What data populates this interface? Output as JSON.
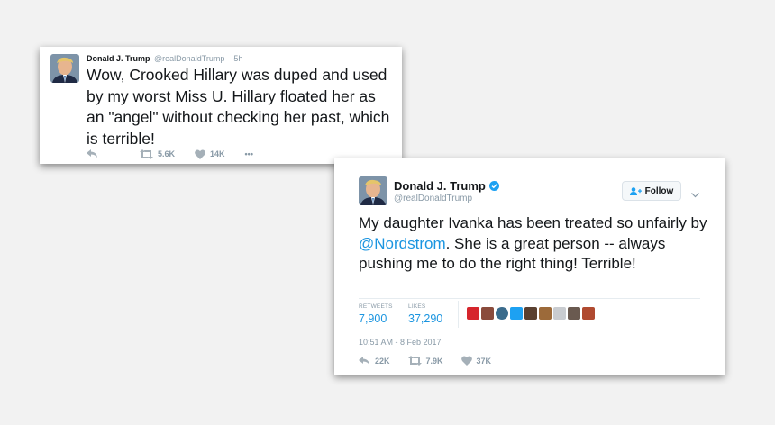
{
  "tweet1": {
    "name": "Donald J. Trump",
    "handle": "@realDonaldTrump",
    "time": "· 5h",
    "text": "Wow, Crooked Hillary was duped and used by my worst Miss U. Hillary floated her as an \"angel\" without checking her past, which is terrible!",
    "retweets": "5.6K",
    "likes": "14K",
    "more": "•••"
  },
  "tweet2": {
    "name": "Donald J. Trump",
    "handle": "@realDonaldTrump",
    "follow_label": "Follow",
    "text_before": "My daughter Ivanka has been treated so unfairly by ",
    "mention": "@Nordstrom",
    "text_after": ". She is a great person -- always pushing me to do the right thing! Terrible!",
    "retweets_label": "RETWEETS",
    "retweets_value": "7,900",
    "likes_label": "LIKES",
    "likes_value": "37,290",
    "timestamp": "10:51 AM - 8 Feb 2017",
    "replies": "22K",
    "retweet_count": "7.9K",
    "like_count": "37K",
    "liker_colors": [
      "#d6252c",
      "#8a4b3c",
      "#3a6b8c",
      "#1da1f2",
      "#5a4030",
      "#9c6a3a",
      "#c9ccd0",
      "#6a5a50",
      "#b04a30"
    ]
  },
  "colors": {
    "link": "#1b95e0",
    "verified": "#1da1f2",
    "muted": "#8899a6"
  }
}
